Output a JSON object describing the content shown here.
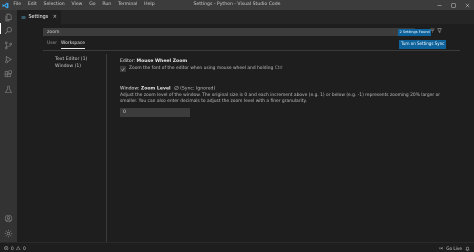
{
  "titlebar": {
    "menu": [
      "File",
      "Edit",
      "Selection",
      "View",
      "Go",
      "Run",
      "Terminal",
      "Help"
    ],
    "window_title": "Settings - Python - Visual Studio Code"
  },
  "tab": {
    "label": "Settings",
    "close": "×"
  },
  "search": {
    "value": "zoom",
    "results": "2 Settings Found"
  },
  "settings_tabs": {
    "user": "User",
    "workspace": "Workspace"
  },
  "sync_button": "Turn on Settings Sync",
  "toc": [
    "Text Editor (1)",
    "Window (1)"
  ],
  "settings": {
    "mouse_wheel_zoom": {
      "category": "Editor: ",
      "name": "Mouse Wheel Zoom",
      "description": "Zoom the font of the editor when using mouse wheel and holding ",
      "key": "Ctrl",
      "checked": true
    },
    "zoom_level": {
      "category": "Window: ",
      "name": "Zoom Level",
      "sync_note": "(Sync: Ignored)",
      "description": "Adjust the zoom level of the window. The original size is 0 and each increment above (e.g. 1) or below (e.g. -1) represents zooming 20% larger or smaller. You can also enter decimals to adjust the zoom level with a finer granularity.",
      "value": "0"
    }
  },
  "statusbar": {
    "errors": "0",
    "warnings": "0",
    "live": "Go Live"
  },
  "colors": {
    "accent": "#0e639c",
    "titlebar": "#3c3c3c",
    "activitybar": "#333333",
    "editor": "#1e1e1e"
  },
  "icons": [
    "vscode-logo-icon",
    "files-icon",
    "search-icon",
    "source-control-icon",
    "run-debug-icon",
    "extensions-icon",
    "test-icon",
    "account-icon",
    "gear-icon"
  ]
}
